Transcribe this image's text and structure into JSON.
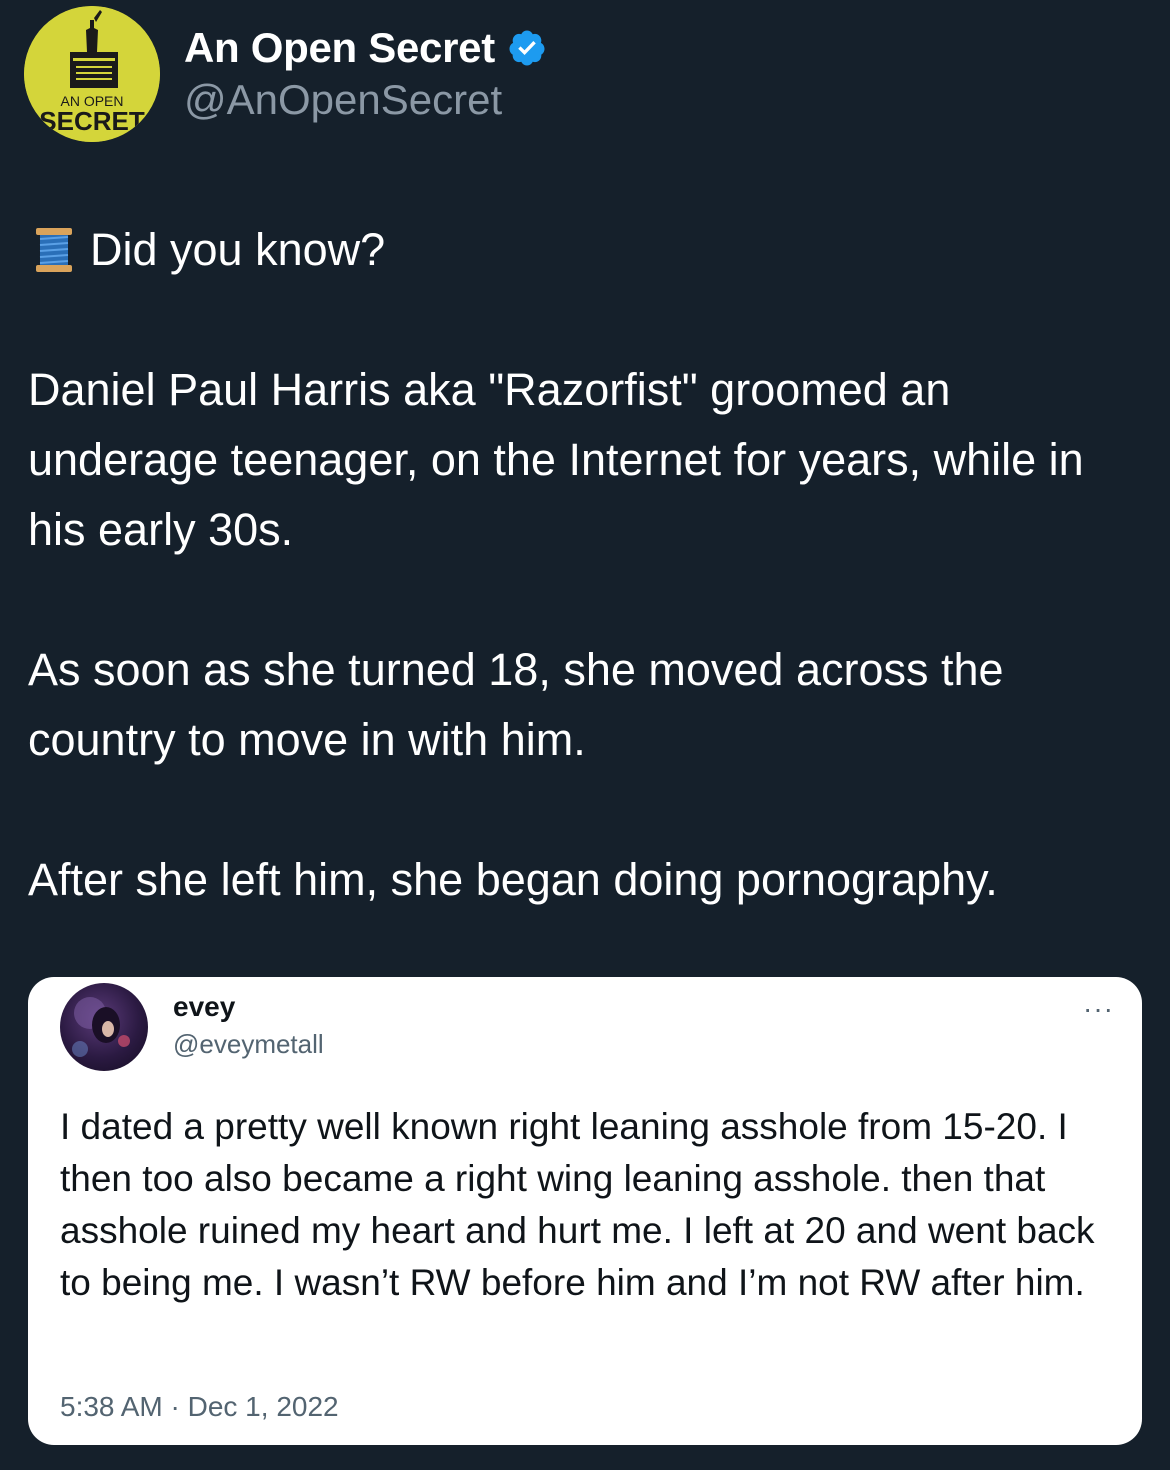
{
  "author": {
    "name": "An Open Secret",
    "handle": "@AnOpenSecret",
    "avatar_text_top": "AN OPEN",
    "avatar_text_bottom": "SECRET",
    "avatar_color": "#d4d53a",
    "verified": true,
    "verified_color": "#1d9bf0"
  },
  "tweet": {
    "thread_icon": "spool-of-thread-icon",
    "line1": "Did you know?",
    "para1": "Daniel Paul Harris aka \"Razorfist\" groomed an underage teenager, on the Internet for years, while in his early 30s.",
    "para2": "As soon as she turned 18, she moved across the country to move in with him.",
    "para3": "After she left him, she began doing pornography."
  },
  "quote": {
    "name": "evey",
    "handle": "@eveymetall",
    "more": "···",
    "text": "I dated a pretty well known right leaning asshole from 15-20. I then too also became a right wing leaning asshole. then that asshole ruined my heart and hurt me. I left at 20 and went back to being me. I wasn’t RW before him and I’m not RW after him.",
    "timestamp": "5:38 AM · Dec 1, 2022"
  },
  "colors": {
    "background": "#15202b",
    "secondary_text": "#8b98a5",
    "card_background": "#ffffff"
  }
}
